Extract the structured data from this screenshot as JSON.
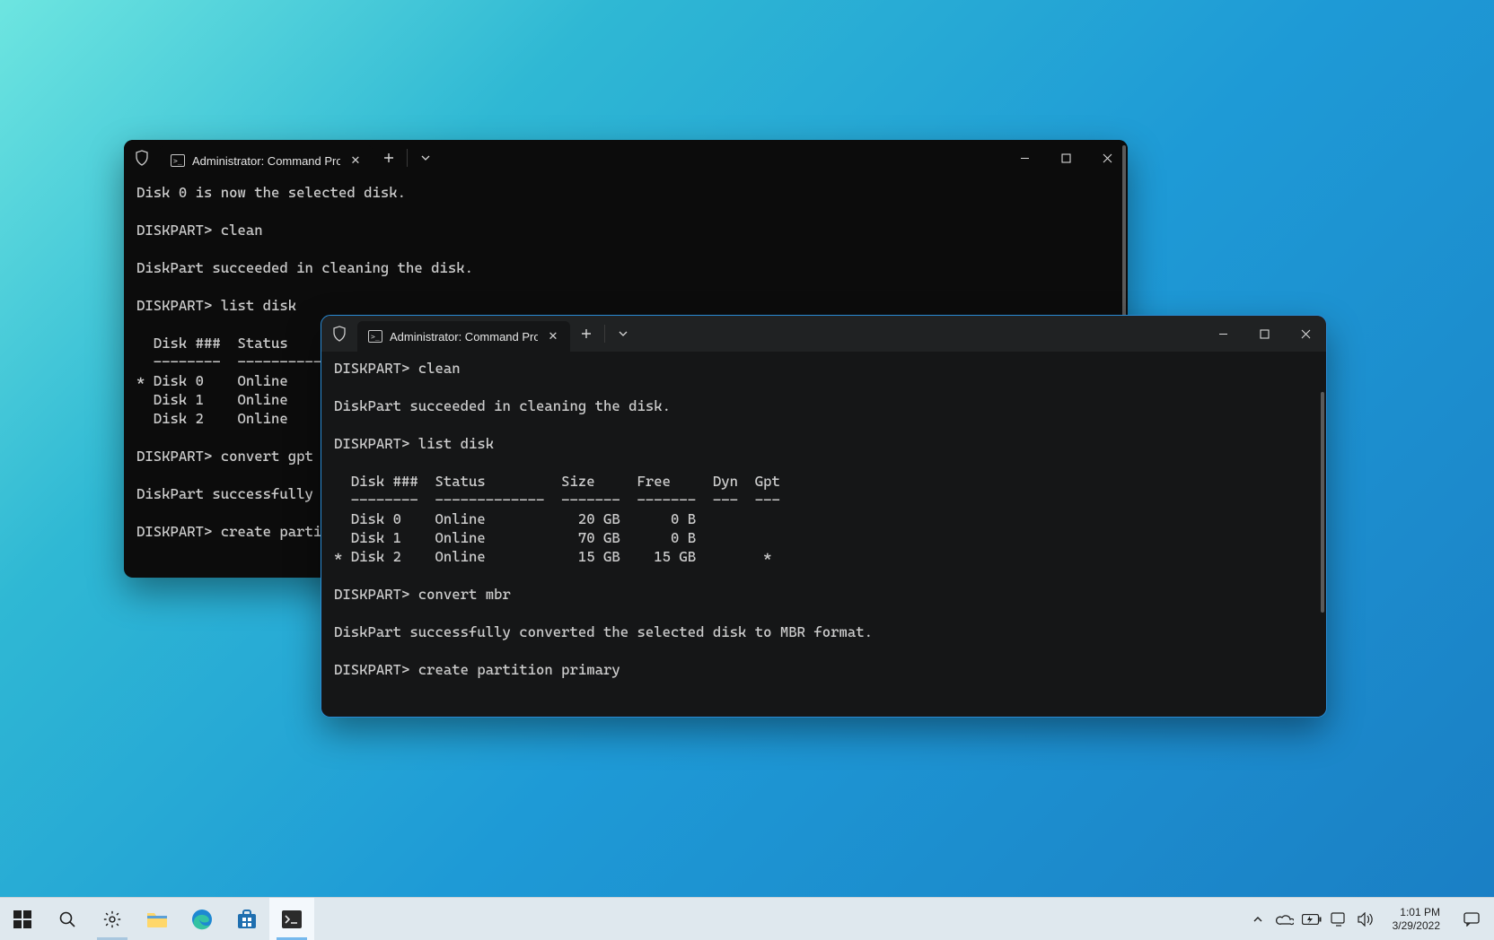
{
  "window_back": {
    "tab_title": "Administrator: Command Prompt",
    "terminal_text": "Disk 0 is now the selected disk.\n\nDISKPART> clean\n\nDiskPart succeeded in cleaning the disk.\n\nDISKPART> list disk\n\n  Disk ###  Status\n  --------  -------------\n* Disk 0    Online\n  Disk 1    Online\n  Disk 2    Online\n\nDISKPART> convert gpt\n\nDiskPart successfully c\n\nDISKPART> create partit"
  },
  "window_front": {
    "tab_title": "Administrator: Command Prompt",
    "terminal_text": "DISKPART> clean\n\nDiskPart succeeded in cleaning the disk.\n\nDISKPART> list disk\n\n  Disk ###  Status         Size     Free     Dyn  Gpt\n  --------  -------------  -------  -------  ---  ---\n  Disk 0    Online           20 GB      0 B\n  Disk 1    Online           70 GB      0 B\n* Disk 2    Online           15 GB    15 GB        *\n\nDISKPART> convert mbr\n\nDiskPart successfully converted the selected disk to MBR format.\n\nDISKPART> create partition primary"
  },
  "taskbar": {
    "clock_time": "1:01 PM",
    "clock_date": "3/29/2022"
  }
}
